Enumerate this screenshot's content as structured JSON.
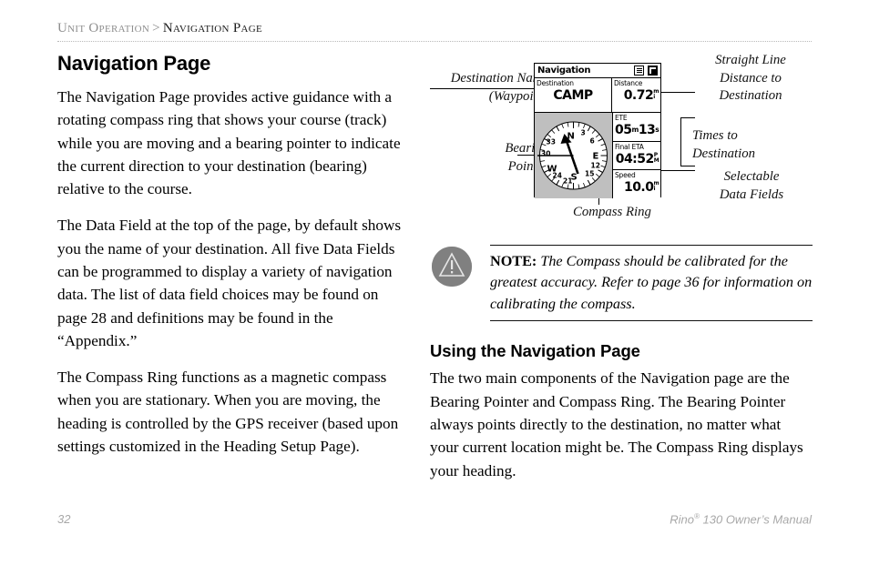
{
  "header": {
    "breadcrumb_parent": "Unit Operation",
    "breadcrumb_separator": ">",
    "breadcrumb_current": "Navigation Page"
  },
  "left_column": {
    "title": "Navigation Page",
    "paragraphs": [
      "The Navigation Page provides active guidance with a rotating compass ring that shows your course (track) while you are moving and a bearing pointer to indicate the current direction to your destination (bearing) relative to the course.",
      "The Data Field at the top of the page, by default shows you the name of your destination. All five Data Fields can be programmed to display a variety of navigation data. The list of data field choices may be found on page 28 and definitions may be found in the “Appendix.”",
      "The Compass Ring functions as a magnetic compass when you are stationary. When you are moving, the heading is controlled by the GPS receiver (based upon settings customized in the Heading Setup Page)."
    ]
  },
  "figure": {
    "callouts": {
      "destination_name": "Destination Name\n(Waypoint)",
      "destination_name_line1": "Destination Name",
      "destination_name_line2": "(Waypoint)",
      "bearing_pointer_line1": "Bearing",
      "bearing_pointer_line2": "Pointer",
      "compass_ring": "Compass Ring",
      "straight_line_l1": "Straight Line",
      "straight_line_l2": "Distance to",
      "straight_line_l3": "Destination",
      "times_l1": "Times to",
      "times_l2": "Destination",
      "selectable_l1": "Selectable",
      "selectable_l2": "Data Fields"
    },
    "device_screen": {
      "title": "Navigation",
      "title_icons": [
        "menu-icon",
        "page-icon"
      ],
      "fields": [
        {
          "label": "Destination",
          "value": "CAMP",
          "unit": ""
        },
        {
          "label": "Distance",
          "value": "0.72",
          "unit": "mi"
        },
        {
          "label": "ETE",
          "value": "05m13s",
          "value_main": "05",
          "unit_1": "m",
          "value_2": "13",
          "unit_2": "s"
        },
        {
          "label": "Final ETA",
          "value": "04:52",
          "unit": "PM"
        },
        {
          "label": "Speed",
          "value": "10.0",
          "unit": "mi"
        }
      ],
      "compass": {
        "cardinals": [
          "N",
          "E",
          "S",
          "W"
        ],
        "tick_labels": [
          "3",
          "6",
          "12",
          "15",
          "21",
          "24",
          "30",
          "33"
        ],
        "bearing_pointer": "bearing-pointer-arrow",
        "course_line": "course-line"
      }
    }
  },
  "note": {
    "icon": "warning-triangle-icon",
    "label": "NOTE:",
    "text": "The Compass should be calibrated for the greatest accuracy. Refer to page 36 for information on calibrating the compass."
  },
  "right_column": {
    "heading": "Using the Navigation Page",
    "paragraph": "The two main components of the Navigation page are the Bearing Pointer and Compass Ring. The Bearing Pointer always points directly to the destination, no matter what your current location might be. The Compass Ring displays your heading."
  },
  "footer": {
    "page_number": "32",
    "manual_prefix": "Rino",
    "manual_sup": "®",
    "manual_suffix": " 130 Owner’s Manual"
  },
  "colors": {
    "breadcrumb_gray": "#8d8d8d",
    "footer_gray": "#a8a8a8",
    "note_icon_gray": "#808080",
    "compass_pane_gray": "#bfbfbf"
  }
}
